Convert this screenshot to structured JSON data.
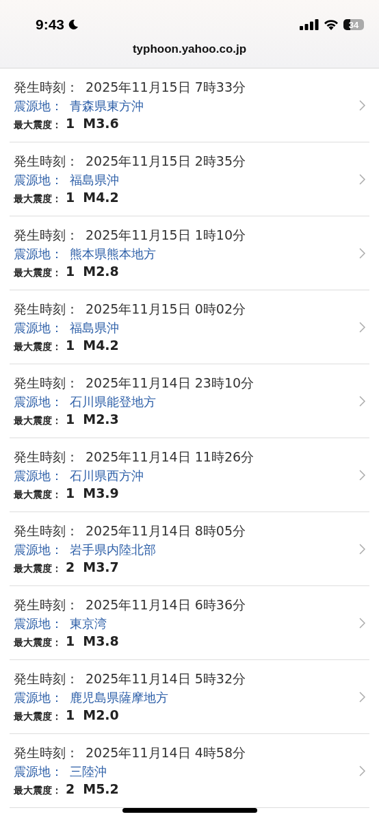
{
  "status_bar": {
    "time": "9:43",
    "battery": "34"
  },
  "address_bar": {
    "url": "typhoon.yahoo.co.jp"
  },
  "quakes": [
    {
      "time_label": "発生時刻：",
      "time": "2025年11月15日 7時33分",
      "place_label": "震源地：",
      "place": "青森県東方沖",
      "intensity_label": "最大震度：",
      "intensity": "1",
      "magnitude": "M3.6"
    },
    {
      "time_label": "発生時刻：",
      "time": "2025年11月15日 2時35分",
      "place_label": "震源地：",
      "place": "福島県沖",
      "intensity_label": "最大震度：",
      "intensity": "1",
      "magnitude": "M4.2"
    },
    {
      "time_label": "発生時刻：",
      "time": "2025年11月15日 1時10分",
      "place_label": "震源地：",
      "place": "熊本県熊本地方",
      "intensity_label": "最大震度：",
      "intensity": "1",
      "magnitude": "M2.8"
    },
    {
      "time_label": "発生時刻：",
      "time": "2025年11月15日 0時02分",
      "place_label": "震源地：",
      "place": "福島県沖",
      "intensity_label": "最大震度：",
      "intensity": "1",
      "magnitude": "M4.2"
    },
    {
      "time_label": "発生時刻：",
      "time": "2025年11月14日 23時10分",
      "place_label": "震源地：",
      "place": "石川県能登地方",
      "intensity_label": "最大震度：",
      "intensity": "1",
      "magnitude": "M2.3"
    },
    {
      "time_label": "発生時刻：",
      "time": "2025年11月14日 11時26分",
      "place_label": "震源地：",
      "place": "石川県西方沖",
      "intensity_label": "最大震度：",
      "intensity": "1",
      "magnitude": "M3.9"
    },
    {
      "time_label": "発生時刻：",
      "time": "2025年11月14日 8時05分",
      "place_label": "震源地：",
      "place": "岩手県内陸北部",
      "intensity_label": "最大震度：",
      "intensity": "2",
      "magnitude": "M3.7"
    },
    {
      "time_label": "発生時刻：",
      "time": "2025年11月14日 6時36分",
      "place_label": "震源地：",
      "place": "東京湾",
      "intensity_label": "最大震度：",
      "intensity": "1",
      "magnitude": "M3.8"
    },
    {
      "time_label": "発生時刻：",
      "time": "2025年11月14日 5時32分",
      "place_label": "震源地：",
      "place": "鹿児島県薩摩地方",
      "intensity_label": "最大震度：",
      "intensity": "1",
      "magnitude": "M2.0"
    },
    {
      "time_label": "発生時刻：",
      "time": "2025年11月14日 4時58分",
      "place_label": "震源地：",
      "place": "三陸沖",
      "intensity_label": "最大震度：",
      "intensity": "2",
      "magnitude": "M5.2"
    }
  ]
}
